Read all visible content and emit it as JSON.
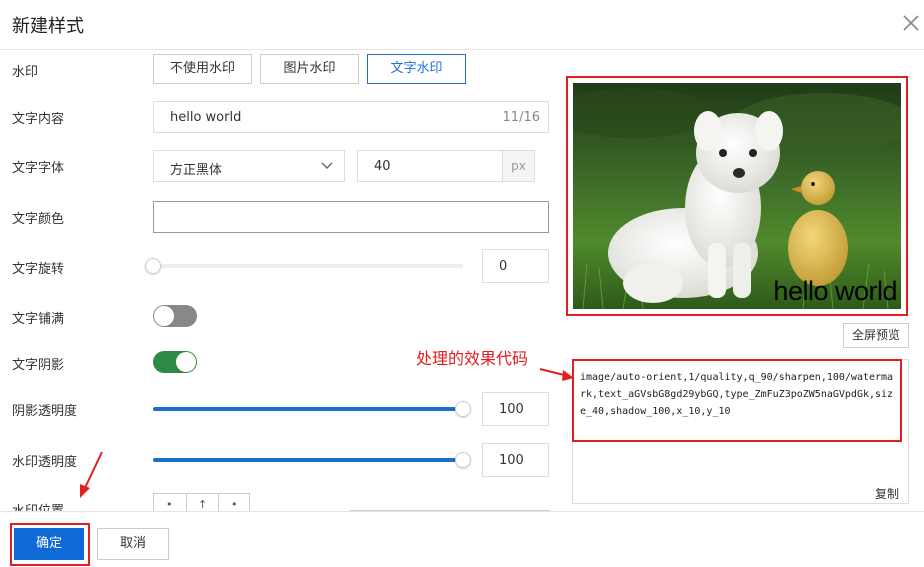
{
  "dialog": {
    "title": "新建样式"
  },
  "labels": {
    "watermark": "水印",
    "text_content": "文字内容",
    "text_font": "文字字体",
    "text_color": "文字颜色",
    "text_rotation": "文字旋转",
    "text_tile": "文字铺满",
    "text_shadow": "文字阴影",
    "shadow_opacity": "阴影透明度",
    "watermark_opacity": "水印透明度",
    "watermark_position": "水印位置"
  },
  "watermark_type": {
    "options": [
      "不使用水印",
      "图片水印",
      "文字水印"
    ],
    "selected": "文字水印"
  },
  "text_content": {
    "value": "hello world",
    "counter": "11/16"
  },
  "font": {
    "family": "方正黑体",
    "size": "40",
    "unit": "px"
  },
  "rotation": {
    "value": "0",
    "level": 0
  },
  "tile": {
    "on": false
  },
  "shadow": {
    "on": true
  },
  "shadow_opacity": {
    "value": "100",
    "level": 1.0
  },
  "watermark_opacity": {
    "value": "100",
    "level": 1.0
  },
  "position_grid": {
    "row1": [
      "•",
      "↑",
      "•"
    ]
  },
  "preview": {
    "watermark_text": "hello world",
    "fullscreen_label": "全屏预览"
  },
  "annotation": {
    "text": "处理的效果代码"
  },
  "code": {
    "value": "image/auto-orient,1/quality,q_90/sharpen,100/watermark,text_aGVsbG8gd29ybGQ,type_ZmFuZ3poZW5naGVpdGk,size_40,shadow_100,x_10,y_10",
    "copy_label": "复制"
  },
  "footer": {
    "ok_label": "确定",
    "cancel_label": "取消"
  },
  "colors": {
    "accent": "#1f6fd6",
    "primary_button": "#0e6ad6",
    "toggle_on": "#2e8b47",
    "annotation": "#e02020"
  }
}
